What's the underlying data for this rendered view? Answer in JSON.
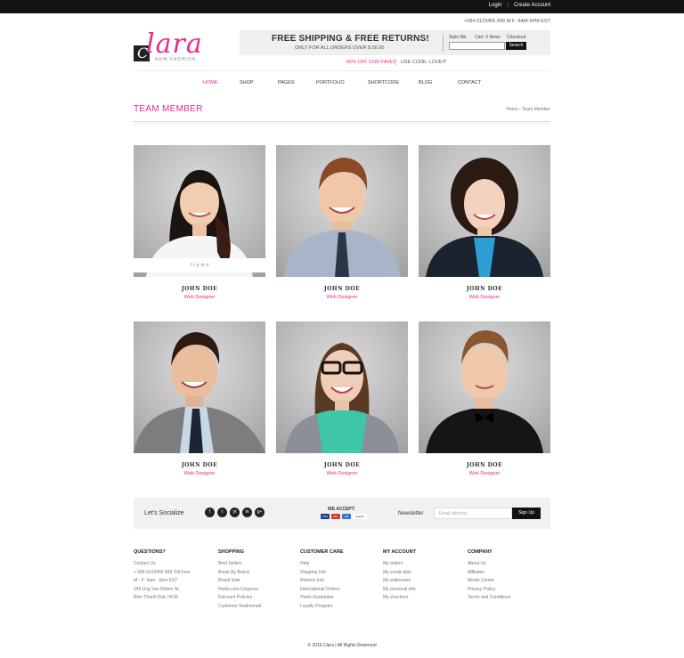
{
  "topbar": {
    "login": "Login",
    "create_account": "Create Account"
  },
  "contact_line": "+084 0123456 999   M-F: 9AM-5PM EST",
  "logo": {
    "script": "lara",
    "initial": "C",
    "tagline": "NEW FASHION"
  },
  "promo": {
    "headline": "FREE SHIPPING & FREE RETURNS!",
    "subline": "ONLY FOR ALL ORDERS OVER $ 50.00",
    "style_me": "Style Me",
    "cart": "Cart: 0 Items",
    "checkout": "Checkout",
    "search_button": "Search"
  },
  "offer": {
    "faves": "50% OFF OUR FAVES",
    "code": "USE CODE: LOVEIT"
  },
  "nav": [
    "HOME",
    "SHOP",
    "PAGES",
    "PORTFOLIO",
    "SHORTCODE",
    "BLOG",
    "CONTACT"
  ],
  "page_title": "TEAM MEMBER",
  "breadcrumb": {
    "home": "Home",
    "sep": "›",
    "current": "Team Member"
  },
  "team": [
    {
      "name": "JOHN DOE",
      "role": "Web Designer",
      "social": [
        "f",
        "t",
        "p",
        "in",
        "d"
      ]
    },
    {
      "name": "JOHN DOE",
      "role": "Web Designer"
    },
    {
      "name": "JOHN DOE",
      "role": "Web Designer"
    },
    {
      "name": "JOHN DOE",
      "role": "Web Designer"
    },
    {
      "name": "JOHN DOE",
      "role": "Web Designer"
    },
    {
      "name": "JOHN DOE",
      "role": "Web Designer"
    }
  ],
  "socialize": {
    "label": "Let's Socialize",
    "icons": [
      "f",
      "t",
      "yt",
      "in",
      "g+"
    ],
    "we_accept": "WE ACCEPT:",
    "cards": [
      "VISA",
      "MC",
      "AE",
      "PayPal"
    ],
    "newsletter": "Newsletter",
    "email_placeholder": "Email address",
    "signup": "Sign Up"
  },
  "footer": [
    {
      "heading": "QUESTIONS?",
      "items": [
        "Contact Us",
        "+ 084 0123456 999 Toll Free",
        "M - F: 9am - 5pm EST",
        "249 Ung Van Khiem St.",
        "Binh Thanh Dist, HCM"
      ]
    },
    {
      "heading": "SHOPPING",
      "items": [
        "Best Sellers",
        "Boots By Brand",
        "Brand Sale",
        "Heels.com Coupons",
        "Discount Policies",
        "Customer Testimonial"
      ]
    },
    {
      "heading": "CUSTOMER CARE",
      "items": [
        "Help",
        "Shipping Info",
        "Returns Info",
        "International Orders",
        "Heels Guarantee",
        "Loyalty Program"
      ]
    },
    {
      "heading": "MY ACCOUNT",
      "items": [
        "My orders",
        "My credit slips",
        "My addresses",
        "My personal info",
        "My vouchers"
      ]
    },
    {
      "heading": "COMPANY",
      "items": [
        "About Us",
        "Affiliates",
        "Media Center",
        "Privacy Policy",
        "Terms and Conditions"
      ]
    }
  ],
  "copyright": "© 2016 Clara  |  All Rights Reserved",
  "colors": {
    "accent": "#e62a86",
    "dark": "#141414"
  }
}
